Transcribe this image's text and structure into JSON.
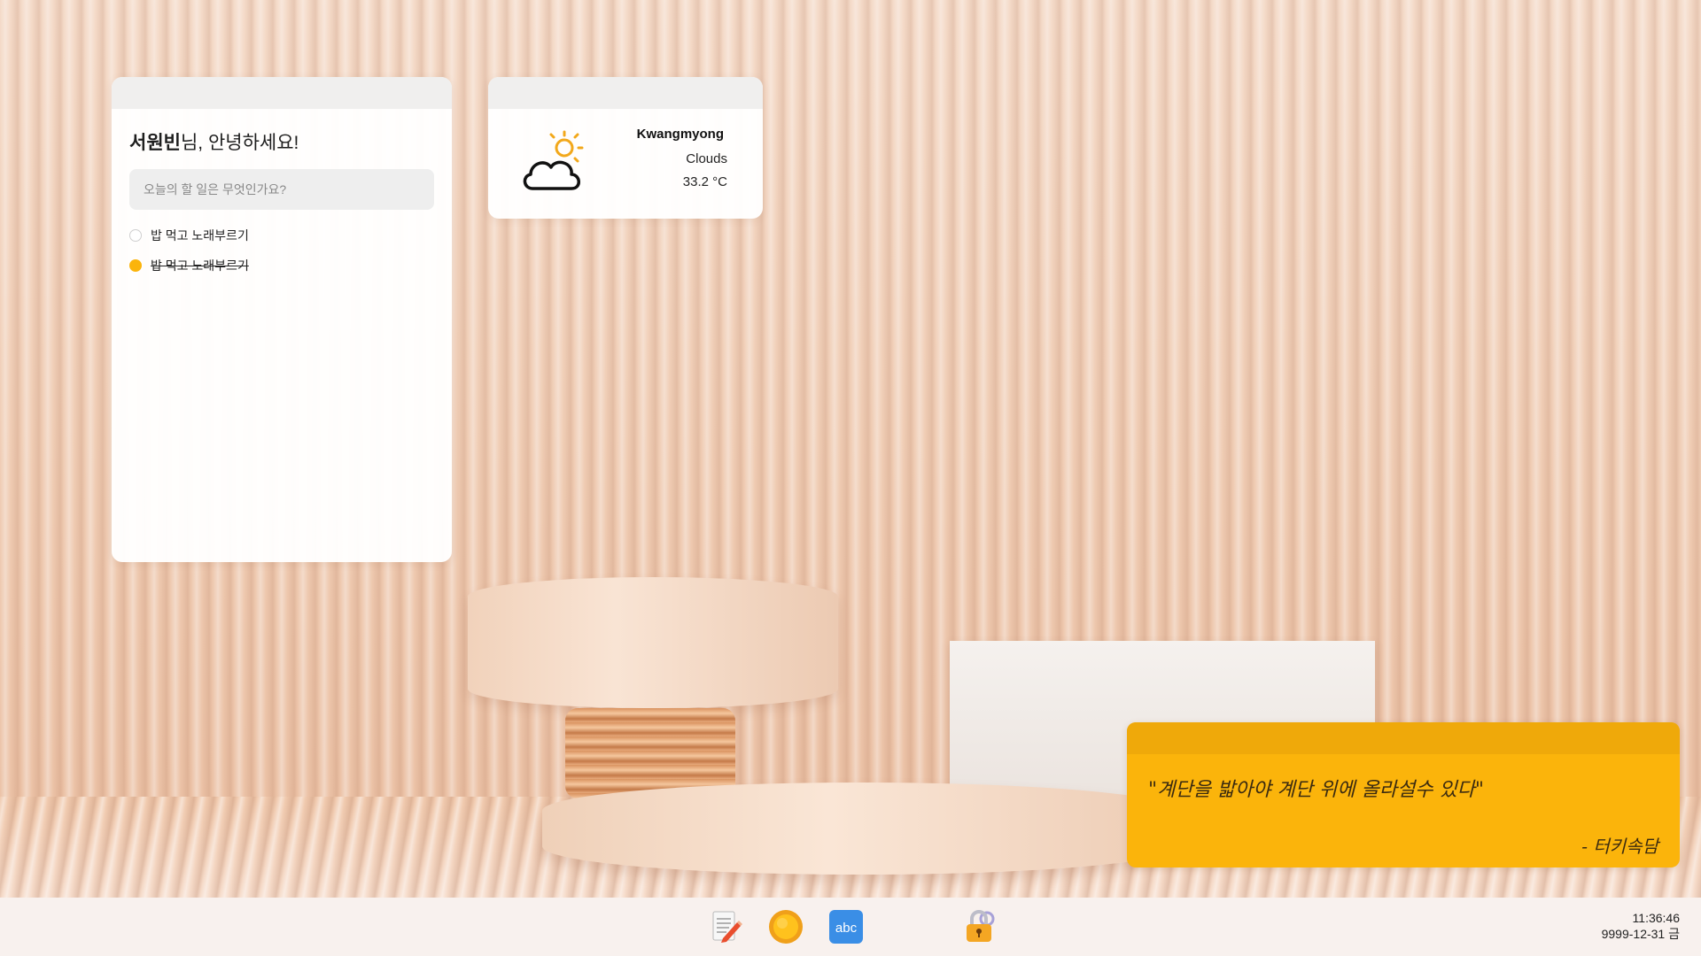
{
  "todo": {
    "greeting_name": "서원빈",
    "greeting_suffix": "님, 안녕하세요!",
    "input_placeholder": "오늘의 할 일은 무엇인가요?",
    "items": [
      {
        "label": "밥 먹고 노래부르기",
        "done": false
      },
      {
        "label": "밥 먹고 노래부르기",
        "done": true
      }
    ]
  },
  "weather": {
    "city": "Kwangmyong",
    "condition": "Clouds",
    "temperature": "33.2 °C",
    "icon": "partly-cloudy-icon"
  },
  "quote": {
    "text": "\"계단을 밟아야 계단 위에 올라설수 있다\"",
    "author": "- 터키속담"
  },
  "taskbar": {
    "apps": [
      {
        "name": "notepad-app-icon"
      },
      {
        "name": "weather-app-icon"
      },
      {
        "name": "spelling-app-icon"
      },
      {
        "name": "lock-app-icon"
      }
    ],
    "time": "11:36:46",
    "date": "9999-12-31 금"
  },
  "colors": {
    "accent": "#fbb40b",
    "quote_header": "#efa90a",
    "widget_header": "#f0efee"
  }
}
